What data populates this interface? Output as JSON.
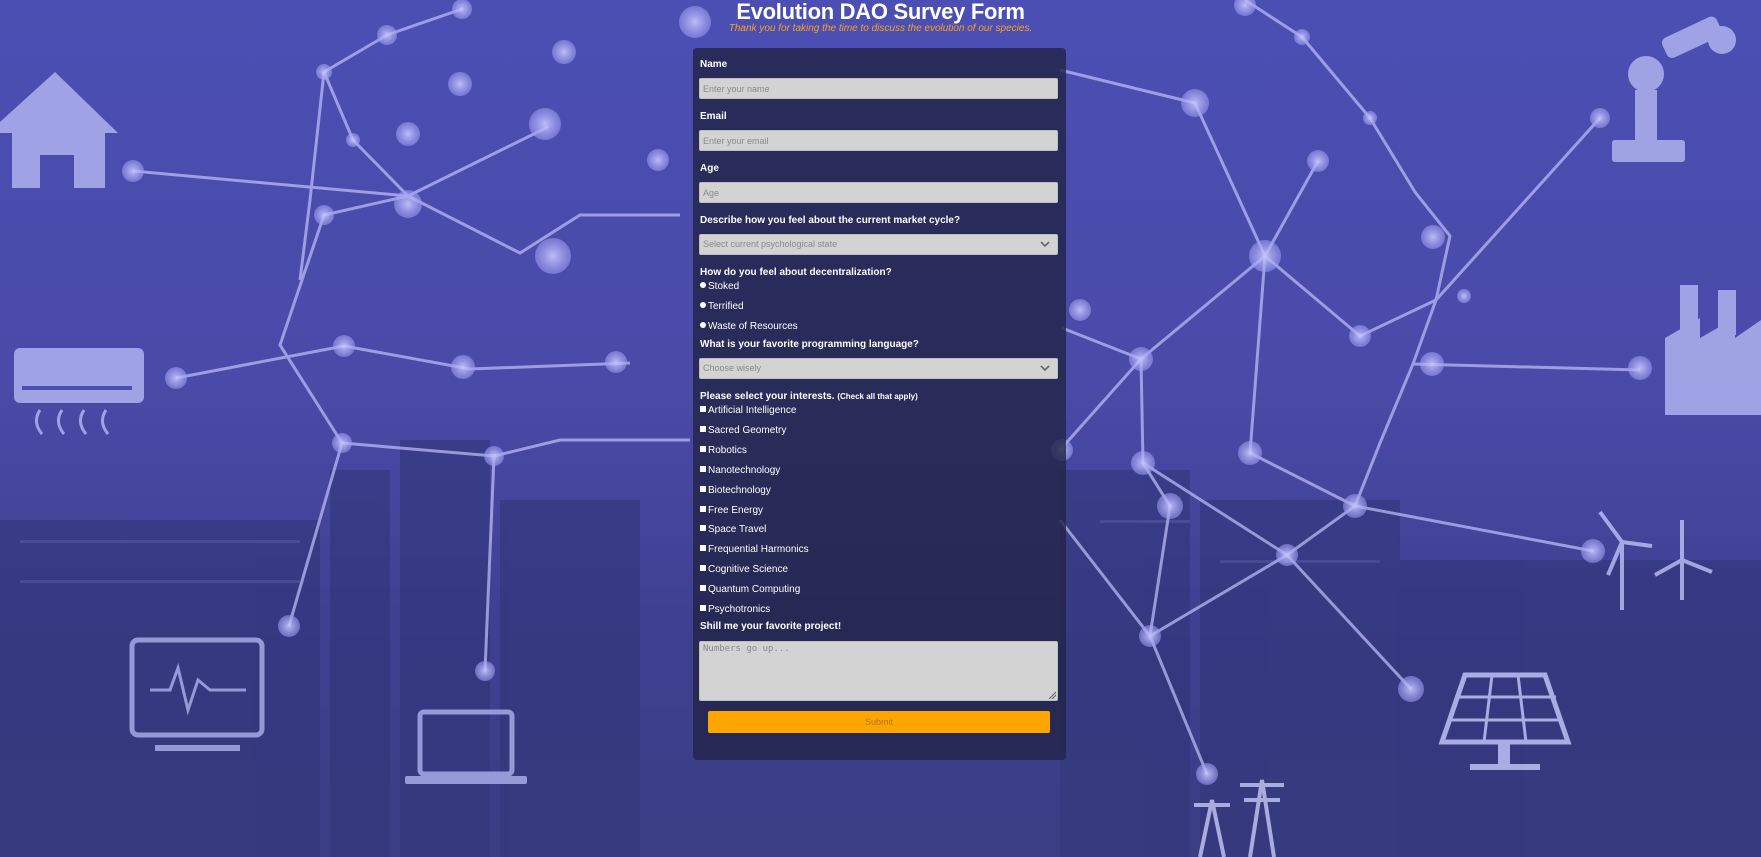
{
  "form": {
    "title": "Evolution DAO Survey Form",
    "subtitle": "Thank you for taking the time to discuss the evolution of our species.",
    "name": {
      "label": "Name",
      "placeholder": "Enter your name"
    },
    "email": {
      "label": "Email",
      "placeholder": "Enter your email"
    },
    "age": {
      "label": "Age",
      "placeholder": "Age"
    },
    "market": {
      "label": "Describe how you feel about the current market cycle?",
      "selected": "Select current psychological state"
    },
    "decentralization": {
      "label": "How do you feel about decentralization?",
      "options": [
        "Stoked",
        "Terrified",
        "Waste of Resources"
      ]
    },
    "language": {
      "label": "What is your favorite programming language?",
      "selected": "Choose wisely"
    },
    "interests": {
      "label": "Please select your interests.",
      "note": "(Check all that apply)",
      "options": [
        "Artificial Intelligence",
        "Sacred Geometry",
        "Robotics",
        "Nanotechnology",
        "Biotechnology",
        "Free Energy",
        "Space Travel",
        "Frequential Harmonics",
        "Cognitive Science",
        "Quantum Computing",
        "Psychotronics"
      ]
    },
    "project": {
      "label": "Shill me your favorite project!",
      "placeholder": "Numbers go up..."
    },
    "submit_label": "Submit"
  },
  "colors": {
    "accent": "#ffa500",
    "subtitle": "#ff9f1c",
    "panel": "#222448",
    "field": "#d3d3d3"
  }
}
